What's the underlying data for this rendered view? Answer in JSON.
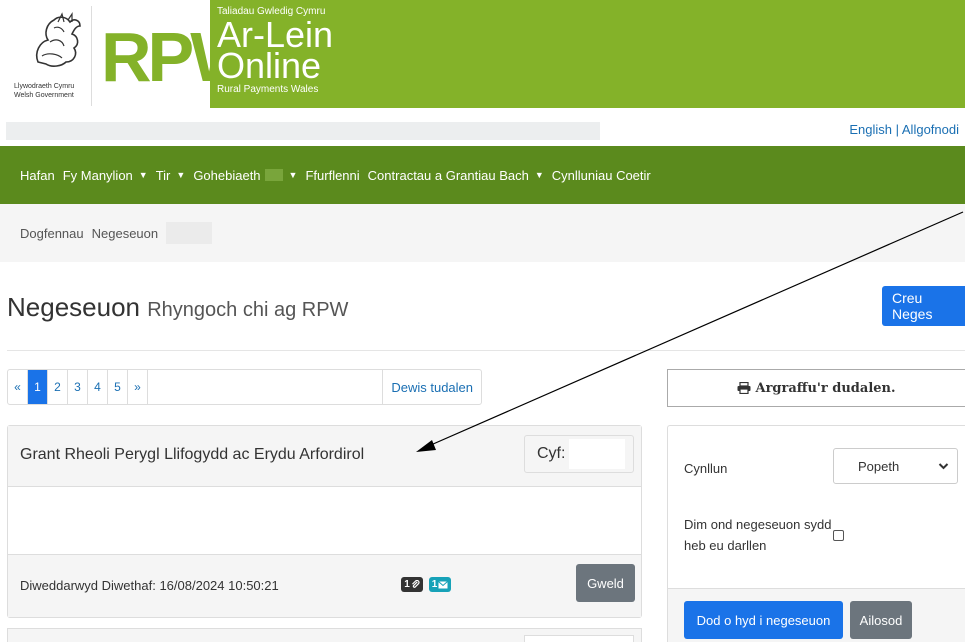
{
  "brand": {
    "gov_line1": "Llywodraeth Cymru",
    "gov_line2": "Welsh Government",
    "rpw": "RPW",
    "tagline": "Taliadau Gwledig Cymru",
    "online_line1": "Ar-Lein",
    "online_line2": "Online",
    "subtitle": "Rural Payments Wales"
  },
  "lang_bar": {
    "english": "English",
    "separator": " | ",
    "logout": "Allgofnodi"
  },
  "nav": {
    "items": [
      {
        "label": "Hafan"
      },
      {
        "label": "Fy Manylion"
      },
      {
        "label": "Tir"
      },
      {
        "label": "Gohebiaeth"
      },
      {
        "label": "Ffurflenni"
      },
      {
        "label": "Contractau a Grantiau Bach"
      },
      {
        "label": "Cynlluniau Coetir"
      }
    ],
    "caret": "▼"
  },
  "breadcrumb": {
    "items": [
      "Dogfennau",
      "Negeseuon"
    ]
  },
  "page": {
    "title": "Negeseuon",
    "subtitle": "Rhyngoch chi ag RPW",
    "create_button": "Creu Neges"
  },
  "pagination": {
    "prev": "«",
    "pages": [
      "1",
      "2",
      "3",
      "4",
      "5"
    ],
    "active_page": "1",
    "next": "»",
    "choose_page": "Dewis tudalen"
  },
  "message": {
    "title": "Grant Rheoli Perygl Llifogydd ac Erydu Arfordirol",
    "ref_label": "Cyf:",
    "updated": "Diweddarwyd Diwethaf: 16/08/2024 10:50:21",
    "attachments_count": "1",
    "messages_count": "1",
    "view_button": "Gweld"
  },
  "sidebar": {
    "print_button": "Argraffu'r dudalen.",
    "scheme_label": "Cynllun",
    "scheme_value": "Popeth",
    "unread_label": "Dim ond negeseuon sydd heb eu darllen",
    "search_button": "Dod o hyd i negeseuon",
    "reset_button": "Ailosod"
  },
  "colors": {
    "brand_green": "#84b229",
    "nav_green": "#5b8a1d",
    "primary_blue": "#1a73e8",
    "secondary_grey": "#6c757d"
  }
}
